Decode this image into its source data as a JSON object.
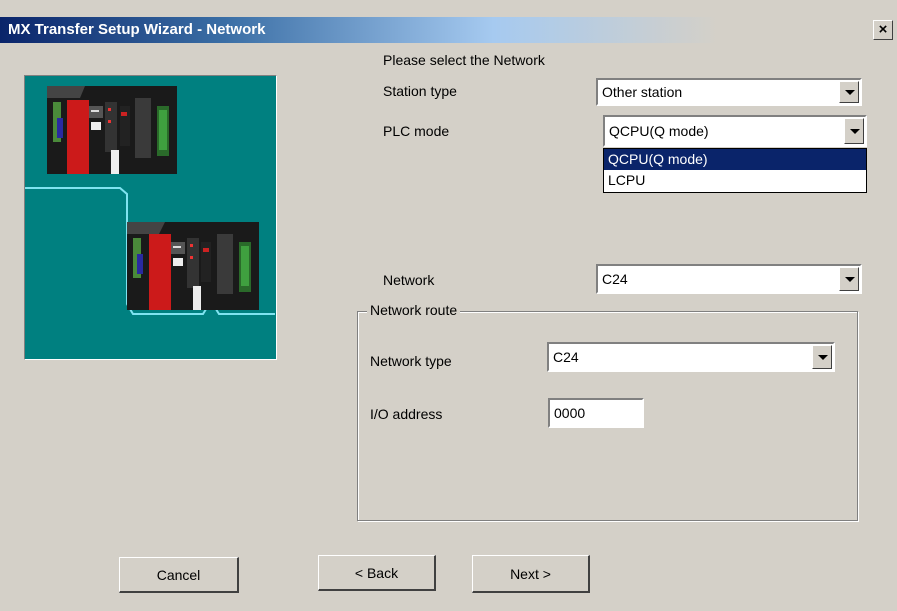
{
  "window": {
    "title": "MX Transfer Setup Wizard - Network",
    "close_label": "×"
  },
  "form": {
    "heading": "Please select the Network",
    "station_type": {
      "label": "Station type",
      "value": "Other station"
    },
    "plc_mode": {
      "label": "PLC mode",
      "value": "QCPU(Q mode)",
      "options": [
        "QCPU(Q mode)",
        "LCPU"
      ],
      "selected_index": 0
    },
    "network": {
      "label": "Network",
      "value": "C24"
    }
  },
  "network_route": {
    "title": "Network route",
    "network_type": {
      "label": "Network type",
      "value": "C24"
    },
    "io_address": {
      "label": "I/O address",
      "value": "0000"
    }
  },
  "buttons": {
    "cancel": "Cancel",
    "back": "< Back",
    "next": "Next >"
  },
  "colors": {
    "title_bar": "#0a246a",
    "illustration_background": "#008080",
    "selection": "#0a246a"
  }
}
